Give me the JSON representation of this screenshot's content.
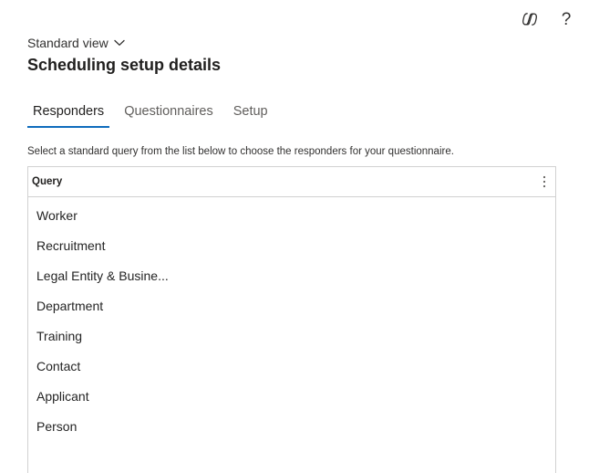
{
  "top_bar": {
    "copilot_icon": "copilot-icon",
    "help_label": "?"
  },
  "view_selector": {
    "label": "Standard view",
    "icon": "chevron-down-icon"
  },
  "page_title": "Scheduling setup details",
  "tabs": [
    {
      "label": "Responders",
      "active": true
    },
    {
      "label": "Questionnaires",
      "active": false
    },
    {
      "label": "Setup",
      "active": false
    }
  ],
  "instruction": "Select a standard query from the list below to choose the responders for your questionnaire.",
  "grid": {
    "column_header": "Query",
    "more_icon": "more-vertical-icon",
    "rows": [
      "Worker",
      "Recruitment",
      "Legal Entity & Busine...",
      "Department",
      "Training",
      "Contact",
      "Applicant",
      "Person"
    ]
  },
  "colors": {
    "accent": "#0f6cbd",
    "border": "#d1d1d1",
    "text": "#242424"
  }
}
